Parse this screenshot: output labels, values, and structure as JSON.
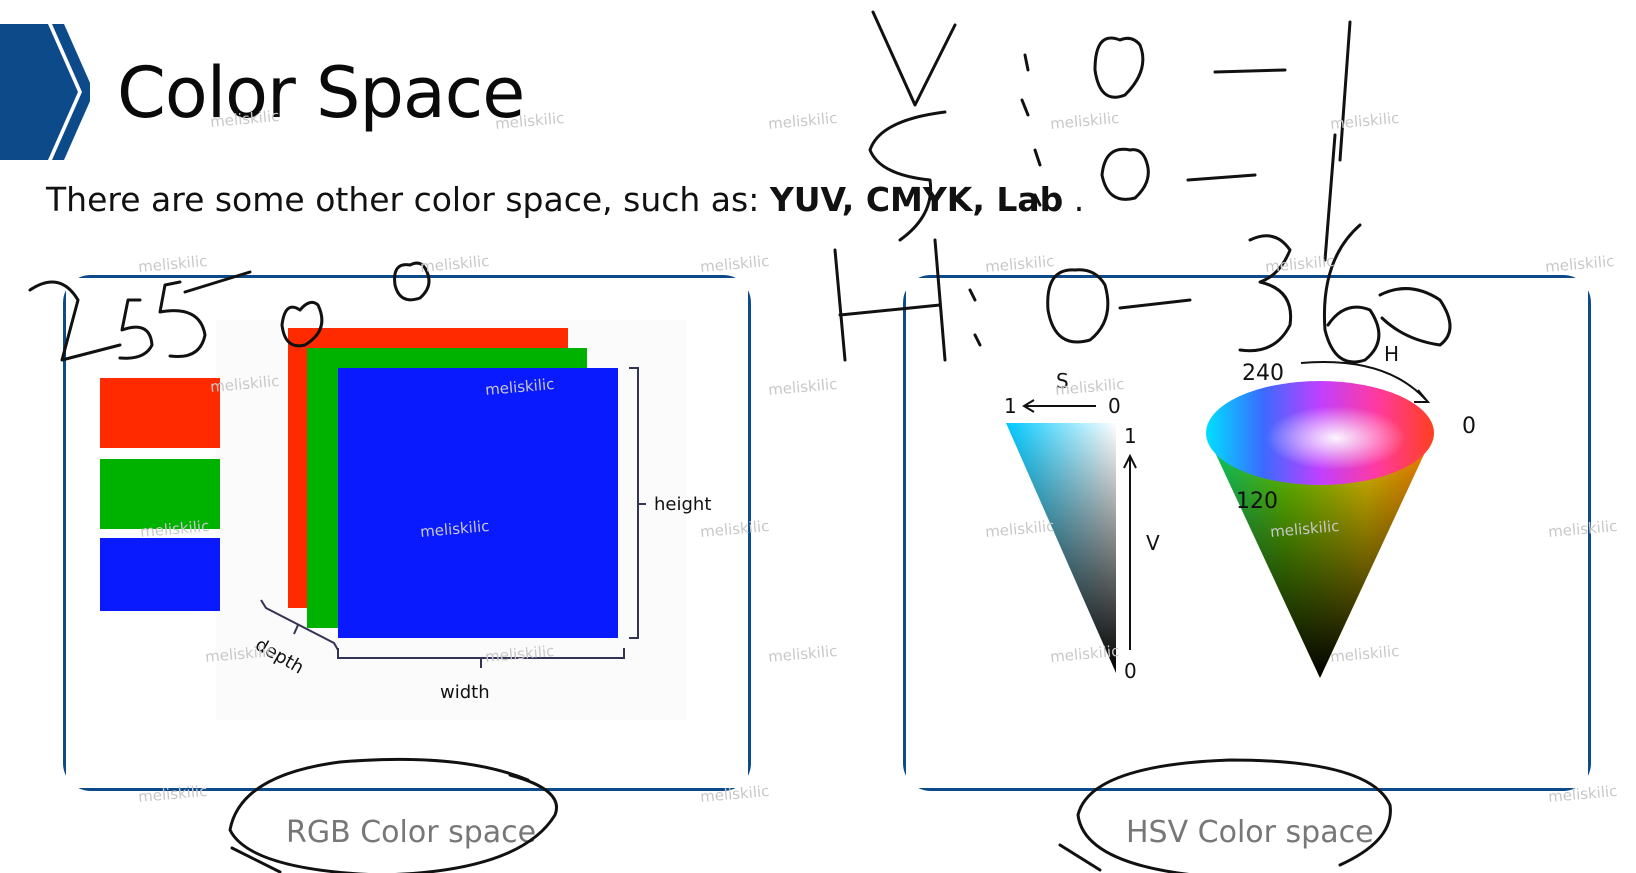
{
  "slide": {
    "title": "Color Space",
    "subtitle_lead": "There are some other color space, such as: ",
    "subtitle_bold": "YUV, CMYK, Lab",
    "subtitle_tail": " ."
  },
  "rgb_panel": {
    "caption": "RGB Color space",
    "labels": {
      "height": "height",
      "width": "width",
      "depth": "depth"
    },
    "swatch_colors": [
      "#ff2a00",
      "#00b200",
      "#0a1aff"
    ]
  },
  "hsv_panel": {
    "caption": "HSV Color space",
    "labels": {
      "s": "S",
      "s_left": "1",
      "s_right": "0",
      "v": "V",
      "v_top": "1",
      "v_bottom": "0",
      "h": "H",
      "h_240": "240",
      "h_0": "0",
      "h_120": "120"
    }
  },
  "watermark": "meliskilic",
  "colors": {
    "accent": "#0d4a8a"
  }
}
